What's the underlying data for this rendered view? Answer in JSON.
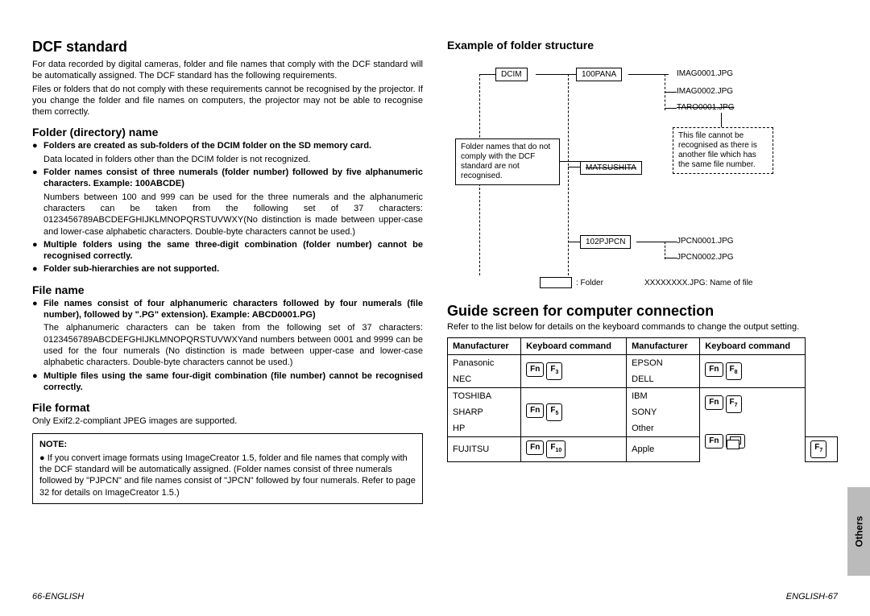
{
  "left": {
    "h1": "DCF standard",
    "intro1": "For data recorded by digital cameras, folder and file names that comply with the DCF standard will be automatically assigned. The DCF standard has the following requirements.",
    "intro2": "Files or folders that do not comply with these requirements cannot be recognised by the projector. If you change the folder and file names on computers, the projector may not be able to recognise them correctly.",
    "folder_h": "Folder (directory) name",
    "folder_b1": "Folders are created as sub-folders of the DCIM folder on the SD memory card.",
    "folder_b1_sub": "Data located in folders other than the DCIM folder is not recognized.",
    "folder_b2": "Folder names consist of three numerals (folder number) followed by five alphanumeric characters. Example: 100ABCDE)",
    "folder_b2_sub": "Numbers between 100 and 999 can be used for the three numerals and the alphanumeric characters can be taken from the following set of 37 characters: 0123456789ABCDEFGHIJKLMNOPQRSTUVWXY(No distinction is made between upper-case and lower-case alphabetic characters. Double-byte characters cannot be used.)",
    "folder_b3": "Multiple folders using the same three-digit combination (folder number) cannot be recognised correctly.",
    "folder_b4": "Folder sub-hierarchies are not supported.",
    "file_h": "File name",
    "file_b1": "File names consist of four alphanumeric characters followed by four numerals (file number), followed by \".PG\" extension). Example: ABCD0001.PG)",
    "file_b1_sub": "The alphanumeric characters can be taken from the following set of 37 characters: 0123456789ABCDEFGHIJKLMNOPQRSTUVWXYand numbers between 0001 and 9999 can be used for the four numerals (No distinction is made between upper-case and lower-case alphabetic characters. Double-byte characters cannot be used.)",
    "file_b2": "Multiple files using the same four-digit combination (file number) cannot be recognised correctly.",
    "fmt_h": "File format",
    "fmt_p": "Only Exif2.2-compliant JPEG images are supported.",
    "note_title": "NOTE:",
    "note_body": "If you convert image formats using ImageCreator 1.5, folder and file names that comply with the DCF standard will be automatically assigned. (Folder names consist of three numerals followed by \"PJPCN\" and file names consist of \"JPCN\" followed by four numerals. Refer to page 32 for details on ImageCreator 1.5.)"
  },
  "right": {
    "ex_h": "Example of folder structure",
    "diagram": {
      "dcim": "DCIM",
      "f1": "100PANA",
      "f2": "MATSUSHITA",
      "f3": "102PJPCN",
      "img1": "IMAG0001.JPG",
      "img2": "IMAG0002.JPG",
      "img3": "TARO0001.JPG",
      "jp1": "JPCN0001.JPG",
      "jp2": "JPCN0002.JPG",
      "callout_left": "Folder names that do not comply with the DCF standard are not recognised.",
      "callout_right": "This file cannot be recognised as there is another file which has the same file number.",
      "legend_folder": ": Folder",
      "legend_file": "XXXXXXXX.JPG: Name of file"
    },
    "guide_h": "Guide screen for computer connection",
    "guide_p": "Refer to the list below for details on the keyboard commands to change the output setting.",
    "table": {
      "headers": [
        "Manufacturer",
        "Keyboard command",
        "Manufacturer",
        "Keyboard command"
      ],
      "rows": [
        {
          "m1": "Panasonic",
          "k1": [
            "Fn",
            "F3"
          ],
          "m2": "EPSON",
          "k2": [
            "Fn",
            "F8"
          ],
          "span1": 2,
          "span2": 2
        },
        {
          "m1": "NEC",
          "m2": "DELL"
        },
        {
          "m1": "TOSHIBA",
          "k1": [
            "Fn",
            "F5"
          ],
          "m2": "IBM",
          "k2": [
            "Fn",
            "F7"
          ],
          "span1": 3,
          "span2": 2,
          "sep": true
        },
        {
          "m1": "SHARP",
          "m2": "SONY"
        },
        {
          "m1": "HP",
          "m2": "Other",
          "k2": [
            "Fn",
            "screen"
          ],
          "span2": 2
        },
        {
          "m1": "FUJITSU",
          "k1": [
            "Fn",
            "F10"
          ],
          "m2": "Apple",
          "k2": [
            "F7"
          ],
          "sep": true
        }
      ]
    }
  },
  "footer": {
    "left_num": "66-",
    "left_lang": "ENGLISH",
    "right_lang": "ENGLISH",
    "right_num": "-67"
  },
  "side_tab": "Others"
}
